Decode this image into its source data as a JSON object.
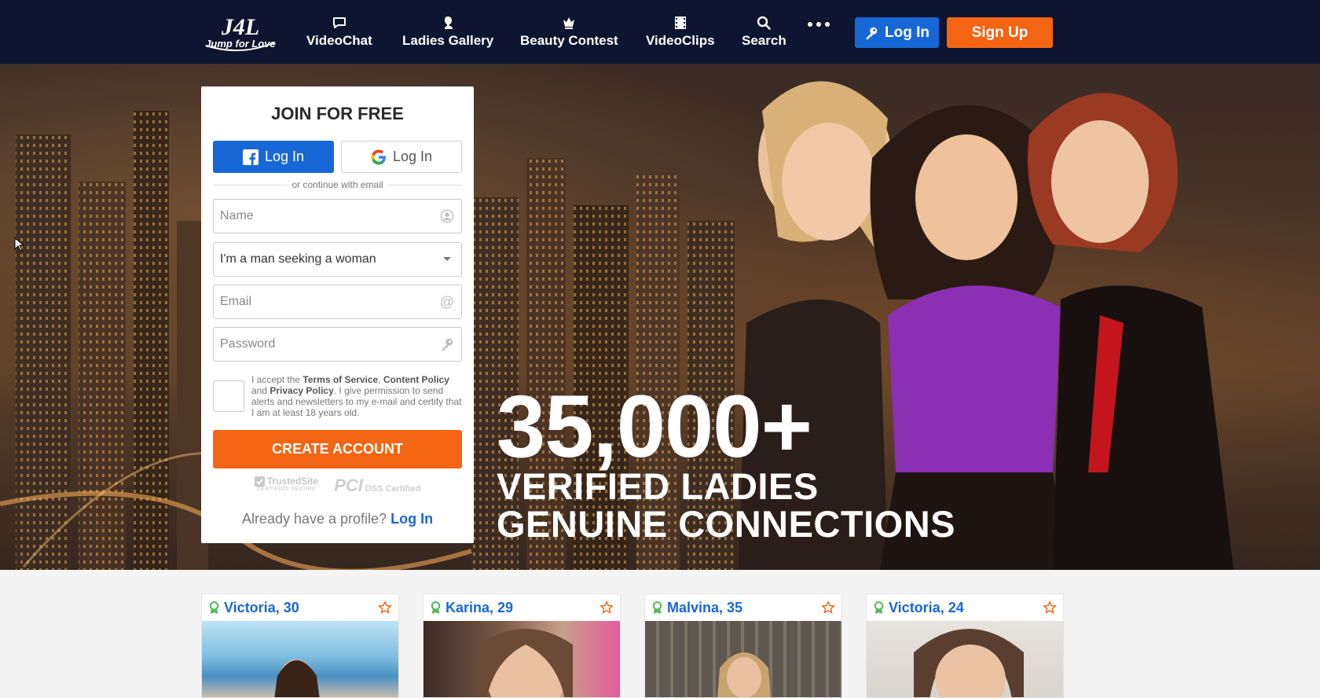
{
  "brand": {
    "logo_text": "J4L",
    "logo_subtext": "Jump for Love"
  },
  "nav": {
    "items": [
      {
        "label": "VideoChat",
        "icon": "chat-bubble-icon"
      },
      {
        "label": "Ladies Gallery",
        "icon": "lady-silhouette-icon"
      },
      {
        "label": "Beauty Contest",
        "icon": "crown-icon"
      },
      {
        "label": "VideoClips",
        "icon": "film-icon"
      },
      {
        "label": "Search",
        "icon": "search-icon"
      }
    ],
    "more_icon": "more-dots-icon",
    "login_label": "Log In",
    "signup_label": "Sign Up"
  },
  "hero": {
    "big_number": "35,000+",
    "line1": "VERIFIED LADIES",
    "line2": "GENUINE CONNECTIONS"
  },
  "signup": {
    "title": "JOIN FOR FREE",
    "facebook_label": "Log In",
    "google_label": "Log In",
    "divider": "or continue with email",
    "name_placeholder": "Name",
    "seeking_value": "I'm a man seeking a woman",
    "email_placeholder": "Email",
    "password_placeholder": "Password",
    "terms_prefix": "I accept the ",
    "terms_link": "Terms of Service",
    "terms_sep": ", ",
    "content_policy_link": "Content Policy",
    "terms_and": " and ",
    "privacy_link": "Privacy Policy",
    "terms_suffix": ". I give permission to send alerts and newsletters to my e-mail and certify that I am at least 18 years old.",
    "create_label": "CREATE ACCOUNT",
    "trusted_label": "TrustedSite",
    "trusted_sub": "CERTIFIED SECURE",
    "pci_label": "PCI",
    "pci_sub": "DSS Certified",
    "already_text": "Already have a profile?",
    "already_link": "Log In"
  },
  "profiles": [
    {
      "name": "Victoria, 30"
    },
    {
      "name": "Karina, 29"
    },
    {
      "name": "Malvina, 35"
    },
    {
      "name": "Victoria, 24"
    }
  ],
  "colors": {
    "nav_bg": "#0d1530",
    "primary_blue": "#1867d6",
    "accent_orange": "#f36512",
    "verified_green": "#57b85b"
  }
}
